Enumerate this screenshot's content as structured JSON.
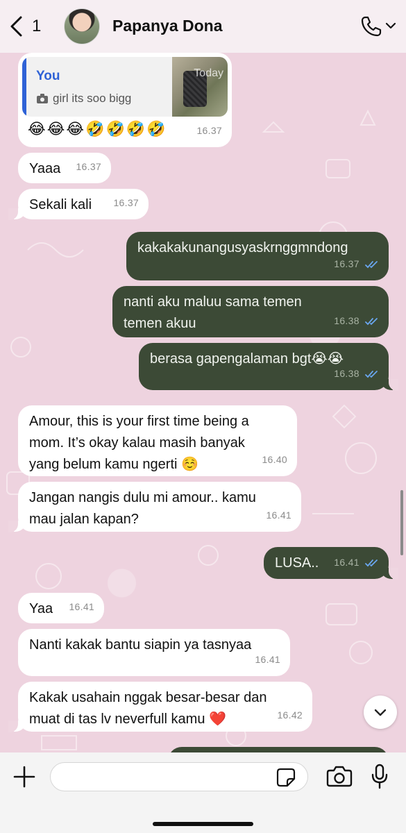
{
  "header": {
    "back_count": "1",
    "contact_name": "Papanya Dona"
  },
  "reply": {
    "author": "You",
    "text": "girl its soo bigg",
    "thumb_stamp": "Today",
    "emojis": "😂😂😂🤣🤣🤣🤣",
    "time": "16.37"
  },
  "messages": [
    {
      "dir": "in",
      "text": "Yaaa",
      "time": "16.37"
    },
    {
      "dir": "in",
      "text": "Sekali kali",
      "time": "16.37"
    },
    {
      "dir": "out",
      "text": "kakakakunangusyaskrnggmndong",
      "time": "16.37"
    },
    {
      "dir": "out",
      "text": "nanti aku maluu sama temen temen akuu",
      "time": "16.38"
    },
    {
      "dir": "out",
      "text": "berasa gapengalaman bgt😭😭",
      "time": "16.38"
    },
    {
      "dir": "in",
      "text": "Amour, this is your first time being a mom. It’s okay kalau masih banyak yang belum kamu ngerti ☺️",
      "time": "16.40"
    },
    {
      "dir": "in",
      "text": "Jangan nangis dulu mi amour.. kamu mau jalan kapan?",
      "time": "16.41"
    },
    {
      "dir": "out",
      "text": "LUSA..",
      "time": "16.41"
    },
    {
      "dir": "in",
      "text": "Yaa",
      "time": "16.41"
    },
    {
      "dir": "in",
      "text": "Nanti kakak bantu siapin ya tasnyaa",
      "time": "16.41"
    },
    {
      "dir": "in",
      "text": "Kakak usahain nggak besar-besar dan muat di tas lv neverfull kamu ❤️",
      "time": "16.42"
    }
  ],
  "icons": {
    "back": "chevron-left-icon",
    "call": "phone-icon",
    "call_menu": "chevron-down-icon",
    "scroll_down": "chevron-down-icon",
    "attach": "plus-icon",
    "sticker": "sticker-icon",
    "camera": "camera-icon",
    "mic": "microphone-icon"
  },
  "colors": {
    "outgoing_bubble": "#3c4a36",
    "incoming_bubble": "#ffffff",
    "wallpaper": "#eed3df",
    "read_ticks": "#6aa7f0",
    "reply_accent": "#2f62d6"
  }
}
